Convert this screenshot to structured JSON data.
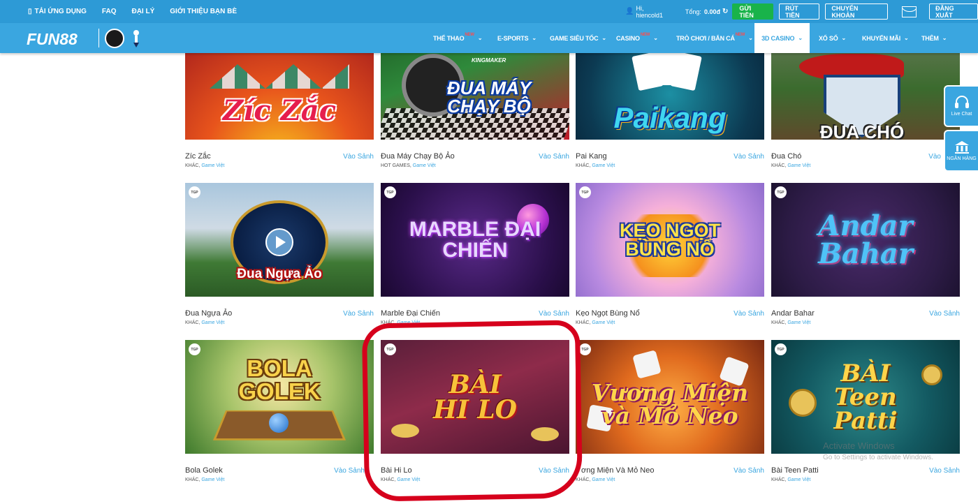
{
  "topbar": {
    "links": [
      "TẢI ỨNG DỤNG",
      "FAQ",
      "ĐẠI LÝ",
      "GIỚI THIỆU BẠN BÈ"
    ],
    "user_greeting": "Hi, hiencold1",
    "balance_label": "Tổng:",
    "balance_value": "0.00đ",
    "deposit": "GỬI TIỀN",
    "withdraw": "RÚT TIỀN",
    "transfer": "CHUYỂN KHOẢN",
    "logout": "ĐĂNG XUẤT"
  },
  "navbar": {
    "logo": "FUN88",
    "items": [
      {
        "label": "THỂ THAO",
        "badge": "NEW"
      },
      {
        "label": "E-SPORTS",
        "badge": ""
      },
      {
        "label": "GAME SIÊU TỐC",
        "badge": ""
      },
      {
        "label": "CASINO",
        "badge": "NEW"
      },
      {
        "label": "TRÒ CHƠI / BẮN CÁ",
        "badge": "NEW"
      },
      {
        "label": "3D CASINO",
        "badge": ""
      },
      {
        "label": "XỔ SỐ",
        "badge": ""
      },
      {
        "label": "KHUYẾN MÃI",
        "badge": ""
      },
      {
        "label": "THÊM",
        "badge": ""
      }
    ]
  },
  "games": [
    {
      "title": "Zíc Zắc",
      "art": "Zíc Zắc",
      "cat": "KHÁC,",
      "provider": "Game Việt",
      "action": "Vào Sảnh",
      "tgp": ""
    },
    {
      "title": "Đua Máy Chạy Bộ Ảo",
      "art": "ĐUA MÁY CHẠY BỘ",
      "art_top": "KINGMAKER",
      "cat": "HOT GAMES,",
      "provider": "Game Việt",
      "action": "Vào Sảnh",
      "tgp": ""
    },
    {
      "title": "Pai Kang",
      "art": "Paikang",
      "cat": "KHÁC,",
      "provider": "Game Việt",
      "action": "Vào Sảnh",
      "tgp": ""
    },
    {
      "title": "Đua Chó",
      "art": "ĐUA CHÓ",
      "cat": "KHÁC,",
      "provider": "Game Việt",
      "action": "Vào",
      "tgp": ""
    },
    {
      "title": "Đua Ngựa Ảo",
      "art": "Đua Ngựa Ảo",
      "cat": "KHÁC,",
      "provider": "Game Việt",
      "action": "Vào Sảnh",
      "tgp": "TGP"
    },
    {
      "title": "Marble Đại Chiến",
      "art": "MARBLE ĐẠI CHIẾN",
      "cat": "KHÁC,",
      "provider": "Game Việt",
      "action": "Vào Sảnh",
      "tgp": "TGP"
    },
    {
      "title": "Kẹo Ngọt Bùng Nổ",
      "art": "KẸO NGỌT BÙNG NỔ",
      "cat": "KHÁC,",
      "provider": "Game Việt",
      "action": "Vào Sảnh",
      "tgp": "TGP"
    },
    {
      "title": "Andar Bahar",
      "art": "Andar Bahar",
      "cat": "KHÁC,",
      "provider": "Game Việt",
      "action": "Vào Sảnh",
      "tgp": "TGP"
    },
    {
      "title": "Bola Golek",
      "art": "BOLA GOLEK",
      "cat": "KHÁC,",
      "provider": "Game Việt",
      "action": "Vào Sảnh",
      "tgp": "TGP"
    },
    {
      "title": "Bài Hi Lo",
      "art": "BÀI HI LO",
      "cat": "KHÁC,",
      "provider": "Game Việt",
      "action": "Vào Sảnh",
      "tgp": "TGP"
    },
    {
      "title": "ơng Miện Và Mỏ Neo",
      "art": "Vương Miện và Mỏ Neo",
      "cat": "KHÁC,",
      "provider": "Game Việt",
      "action": "Vào Sảnh",
      "tgp": "TGP"
    },
    {
      "title": "Bài Teen Patti",
      "art": "BÀI Teen Patti",
      "cat": "KHÁC,",
      "provider": "Game Việt",
      "action": "Vào Sảnh",
      "tgp": "TGP"
    }
  ],
  "side": {
    "live_chat": "Live Chat",
    "bank": "NGÂN HÀNG"
  },
  "watermark": {
    "line1": "Activate Windows",
    "line2": "Go to Settings to activate Windows."
  },
  "colors": {
    "brand": "#3aa6e0",
    "topbar": "#2d9ad6",
    "deposit": "#19b34a",
    "annotation": "#d6001c"
  }
}
